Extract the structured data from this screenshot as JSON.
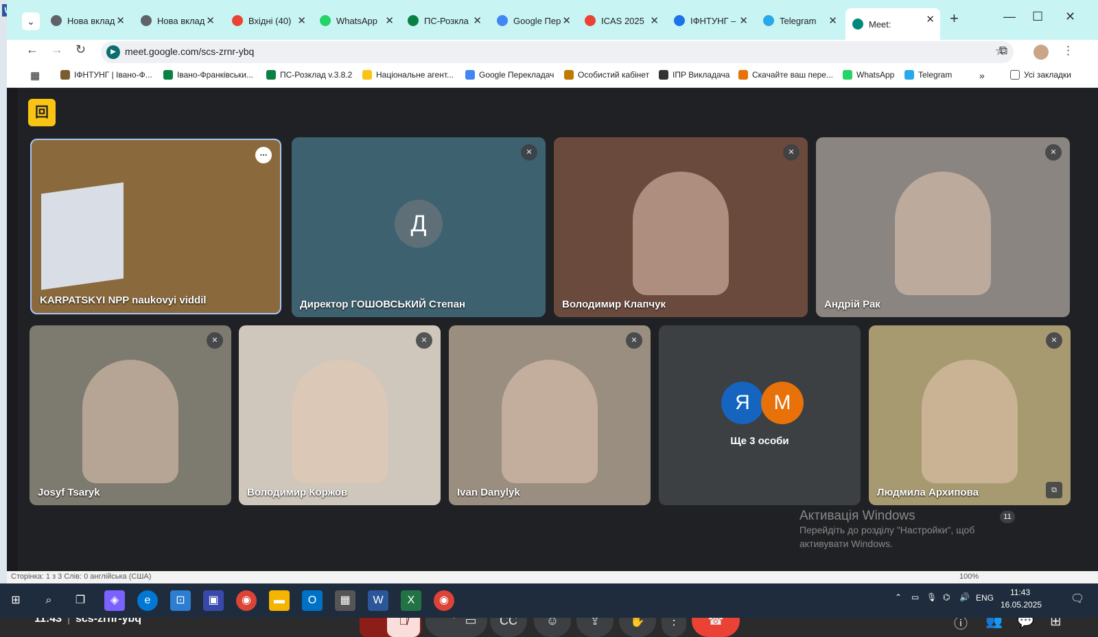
{
  "browser": {
    "tabs": [
      {
        "title": "Нова вклад",
        "color": "#5f6368",
        "icon": "chrome-icon"
      },
      {
        "title": "Нова вклад",
        "color": "#5f6368",
        "icon": "chrome-icon"
      },
      {
        "title": "Вхідні (40)",
        "color": "#ea4335",
        "icon": "gmail-icon"
      },
      {
        "title": "WhatsApp",
        "color": "#25d366",
        "icon": "whatsapp-icon"
      },
      {
        "title": "ПС-Розкла",
        "color": "#0b8043",
        "icon": "pc-schedule-icon"
      },
      {
        "title": "Google Пер",
        "color": "#4285f4",
        "icon": "google-translate-icon"
      },
      {
        "title": "ICAS 2025",
        "color": "#ea4335",
        "icon": "gmail-icon"
      },
      {
        "title": "ІФНТУНГ –",
        "color": "#1a73e8",
        "icon": "calendar-icon"
      },
      {
        "title": "Telegram",
        "color": "#29a9eb",
        "icon": "telegram-icon"
      },
      {
        "title": "Meet: ",
        "color": "#00897b",
        "icon": "meet-icon"
      }
    ],
    "url": "meet.google.com/scs-zrnr-ybq",
    "bookmarks": [
      {
        "label": "ІФНТУНГ | Івано-Ф...",
        "color": "#7a5c2e"
      },
      {
        "label": "Івано-Франківськи...",
        "color": "#0b8043"
      },
      {
        "label": "ПС-Розклад v.3.8.2",
        "color": "#0b8043"
      },
      {
        "label": "Національне агент...",
        "color": "#f9c414"
      },
      {
        "label": "Google Перекладач",
        "color": "#4285f4"
      },
      {
        "label": "Особистий кабінет",
        "color": "#c07a00"
      },
      {
        "label": "ІПР Викладача",
        "color": "#333333"
      },
      {
        "label": "Скачайте ваш пере...",
        "color": "#e8710a"
      },
      {
        "label": "WhatsApp",
        "color": "#25d366"
      },
      {
        "label": "Telegram",
        "color": "#29a9eb"
      }
    ],
    "all_bookmarks": "Усі закладки"
  },
  "meet": {
    "tiles": [
      {
        "name": "KARPATSKYI NPP naukovyi viddil",
        "bg": "#8a6a3c"
      },
      {
        "name": "Директор ГОШОВСЬКИЙ Степан",
        "bg": "#3e6170",
        "avatar": "Д"
      },
      {
        "name": "Володимир Клапчук",
        "bg": "#6b4a3e"
      },
      {
        "name": "Андрій Рак",
        "bg": "#8a8580"
      },
      {
        "name": "Josyf Tsaryk",
        "bg": "#7d7a70"
      },
      {
        "name": "Володимир Коржов",
        "bg": "#cfc7bb"
      },
      {
        "name": "Ivan Danylyk",
        "bg": "#9a8e80"
      },
      {
        "name": "Ще 3 особи",
        "bg": "#3c4043",
        "avatars": [
          "Я",
          "М"
        ]
      },
      {
        "name": "Людмила Архипова",
        "bg": "#a89a70"
      }
    ],
    "time": "11:43",
    "code": "scs-zrnr-ybq",
    "participants_count": "11",
    "activation_title": "Активація Windows",
    "activation_text": "Перейдіть до розділу \"Настройки\", щоб активувати Windows."
  },
  "word_status": "Сторінка: 1 з 3    Слів: 0    англійська (США)",
  "taskbar": {
    "time": "11:43",
    "date": "16.05.2025",
    "lang": "ENG",
    "zoom": "100%"
  }
}
